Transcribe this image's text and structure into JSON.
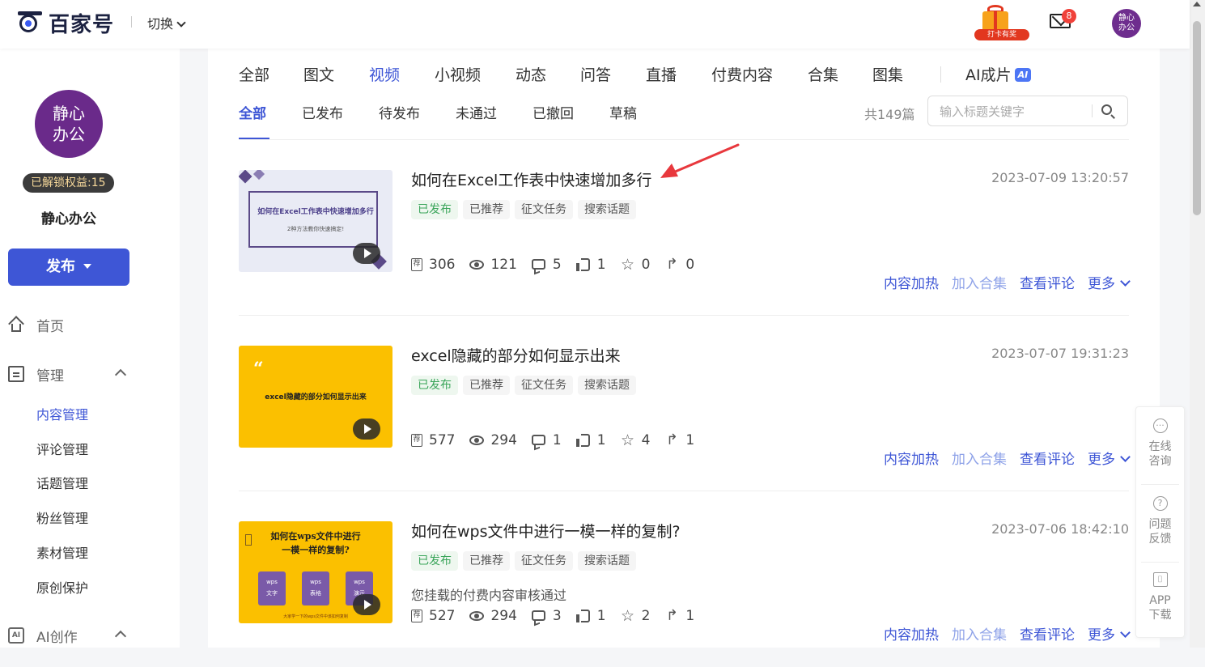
{
  "header": {
    "logo_text": "百家号",
    "switch_label": "切换",
    "gift_label": "打卡有奖",
    "mail_badge": "8",
    "avatar_text": "静心办公"
  },
  "sidebar": {
    "avatar_text": "静心办公",
    "rights_label": "已解锁权益:15",
    "username": "静心办公",
    "publish_label": "发布",
    "nav": [
      {
        "label": "首页",
        "icon": "home-icon"
      },
      {
        "label": "管理",
        "icon": "manage-icon"
      }
    ],
    "sub_items": [
      {
        "label": "内容管理",
        "active": true
      },
      {
        "label": "评论管理"
      },
      {
        "label": "话题管理"
      },
      {
        "label": "粉丝管理"
      },
      {
        "label": "素材管理"
      },
      {
        "label": "原创保护"
      }
    ],
    "ai_section": {
      "label": "AI创作",
      "icon_text": "AI"
    }
  },
  "main": {
    "type_tabs": [
      "全部",
      "图文",
      "视频",
      "小视频",
      "动态",
      "问答",
      "直播",
      "付费内容",
      "合集",
      "图集",
      "AI成片"
    ],
    "active_type_tab": "视频",
    "ai_badge": "AI",
    "status_tabs": [
      "全部",
      "已发布",
      "待发布",
      "未通过",
      "已撤回",
      "草稿"
    ],
    "active_status_tab": "全部",
    "count_text": "共149篇",
    "search": {
      "placeholder": "输入标题关键字",
      "value": ""
    },
    "actions": {
      "heat": "内容加热",
      "add_collection": "加入合集",
      "view_comments": "查看评论",
      "more": "更多"
    },
    "items": [
      {
        "title": "如何在Excel工作表中快速增加多行",
        "date": "2023-07-09 13:20:57",
        "tags": [
          "已发布",
          "已推荐",
          "征文任务",
          "搜索话题"
        ],
        "note": "",
        "stats": {
          "recommend": "306",
          "views": "121",
          "comments": "5",
          "likes": "1",
          "favorites": "0",
          "shares": "0"
        },
        "thumb": {
          "title": "如何在Excel工作表中快速增加多行",
          "subtitle": "2种方法教你快速搞定!"
        }
      },
      {
        "title": "excel隐藏的部分如何显示出来",
        "date": "2023-07-07 19:31:23",
        "tags": [
          "已发布",
          "已推荐",
          "征文任务",
          "搜索话题"
        ],
        "note": "",
        "stats": {
          "recommend": "577",
          "views": "294",
          "comments": "1",
          "likes": "1",
          "favorites": "4",
          "shares": "1"
        },
        "thumb": {
          "quote": "“",
          "title": "excel隐藏的部分如何显示出来"
        }
      },
      {
        "title": "如何在wps文件中进行一模一样的复制?",
        "date": "2023-07-06 18:42:10",
        "tags": [
          "已发布",
          "已推荐",
          "征文任务",
          "搜索话题"
        ],
        "note": "您挂载的付费内容审核通过",
        "stats": {
          "recommend": "527",
          "views": "294",
          "comments": "3",
          "likes": "1",
          "favorites": "2",
          "shares": "1"
        },
        "thumb": {
          "title_line1": "如何在wps文件中进行",
          "title_line2": "一模一样的复制?",
          "cards": [
            [
              "wps",
              "文字"
            ],
            [
              "wps",
              "表格"
            ],
            [
              "wps",
              "演示"
            ]
          ],
          "footer": "大家学一下的wps文件中该如何复制"
        }
      }
    ]
  },
  "helper": [
    {
      "label": "在线咨询",
      "icon": "chat-icon"
    },
    {
      "label": "问题反馈",
      "icon": "question-icon"
    },
    {
      "label": "APP下载",
      "icon": "scan-icon"
    }
  ],
  "colors": {
    "accent": "#3e56d6",
    "published": "#3aa55a",
    "annotation_arrow": "#e8383d"
  }
}
